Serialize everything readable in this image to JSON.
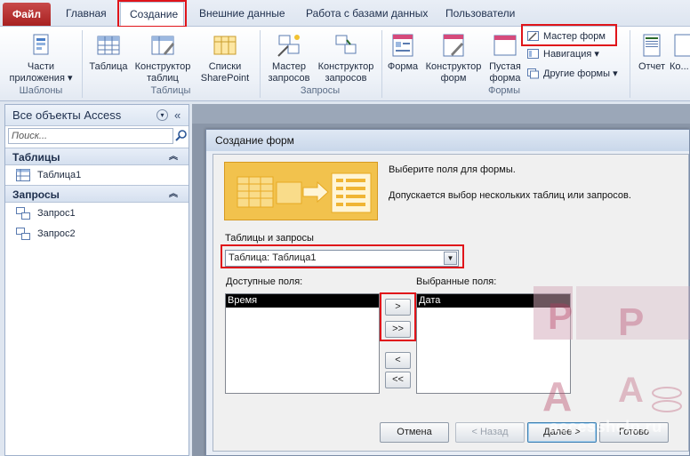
{
  "tabs": [
    "Файл",
    "Главная",
    "Создание",
    "Внешние данные",
    "Работа с базами данных",
    "Пользователи"
  ],
  "ribbon": {
    "templates": {
      "button": "Части\nприложения",
      "label": "Шаблоны"
    },
    "tables": {
      "table": "Таблица",
      "designer": "Конструктор\nтаблиц",
      "sharepoint": "Списки\nSharePoint",
      "label": "Таблицы"
    },
    "queries": {
      "wizard": "Мастер\nзапросов",
      "designer": "Конструктор\nзапросов",
      "label": "Запросы"
    },
    "forms": {
      "form": "Форма",
      "designer": "Конструктор\nформ",
      "blank": "Пустая\nформа",
      "wizard": "Мастер форм",
      "navigation": "Навигация",
      "other": "Другие формы",
      "label": "Формы"
    },
    "reports": {
      "report": "Отчет",
      "designer": "Ко..."
    }
  },
  "nav": {
    "title": "Все объекты Access",
    "search_placeholder": "Поиск...",
    "sections": [
      {
        "label": "Таблицы",
        "items": [
          "Таблица1"
        ]
      },
      {
        "label": "Запросы",
        "items": [
          "Запрос1",
          "Запрос2"
        ]
      }
    ]
  },
  "dialog": {
    "title": "Создание форм",
    "instruction": "Выберите поля для формы.",
    "note": "Допускается выбор нескольких таблиц или запросов.",
    "source_label": "Таблицы и запросы",
    "source_value": "Таблица: Таблица1",
    "available_label": "Доступные поля:",
    "available_fields": [
      "Время"
    ],
    "selected_label": "Выбранные поля:",
    "selected_fields": [
      "Дата"
    ],
    "buttons": {
      "add": ">",
      "add_all": ">>",
      "remove": "<",
      "remove_all": "<<",
      "cancel": "Отмена",
      "back": "< Назад",
      "next": "Далее >",
      "finish": "Готово"
    }
  },
  "watermark": "accesshelp.ru",
  "colors": {
    "highlight": "#e0141a",
    "file_tab": "#b52a2a",
    "banner": "#f2c24d"
  }
}
